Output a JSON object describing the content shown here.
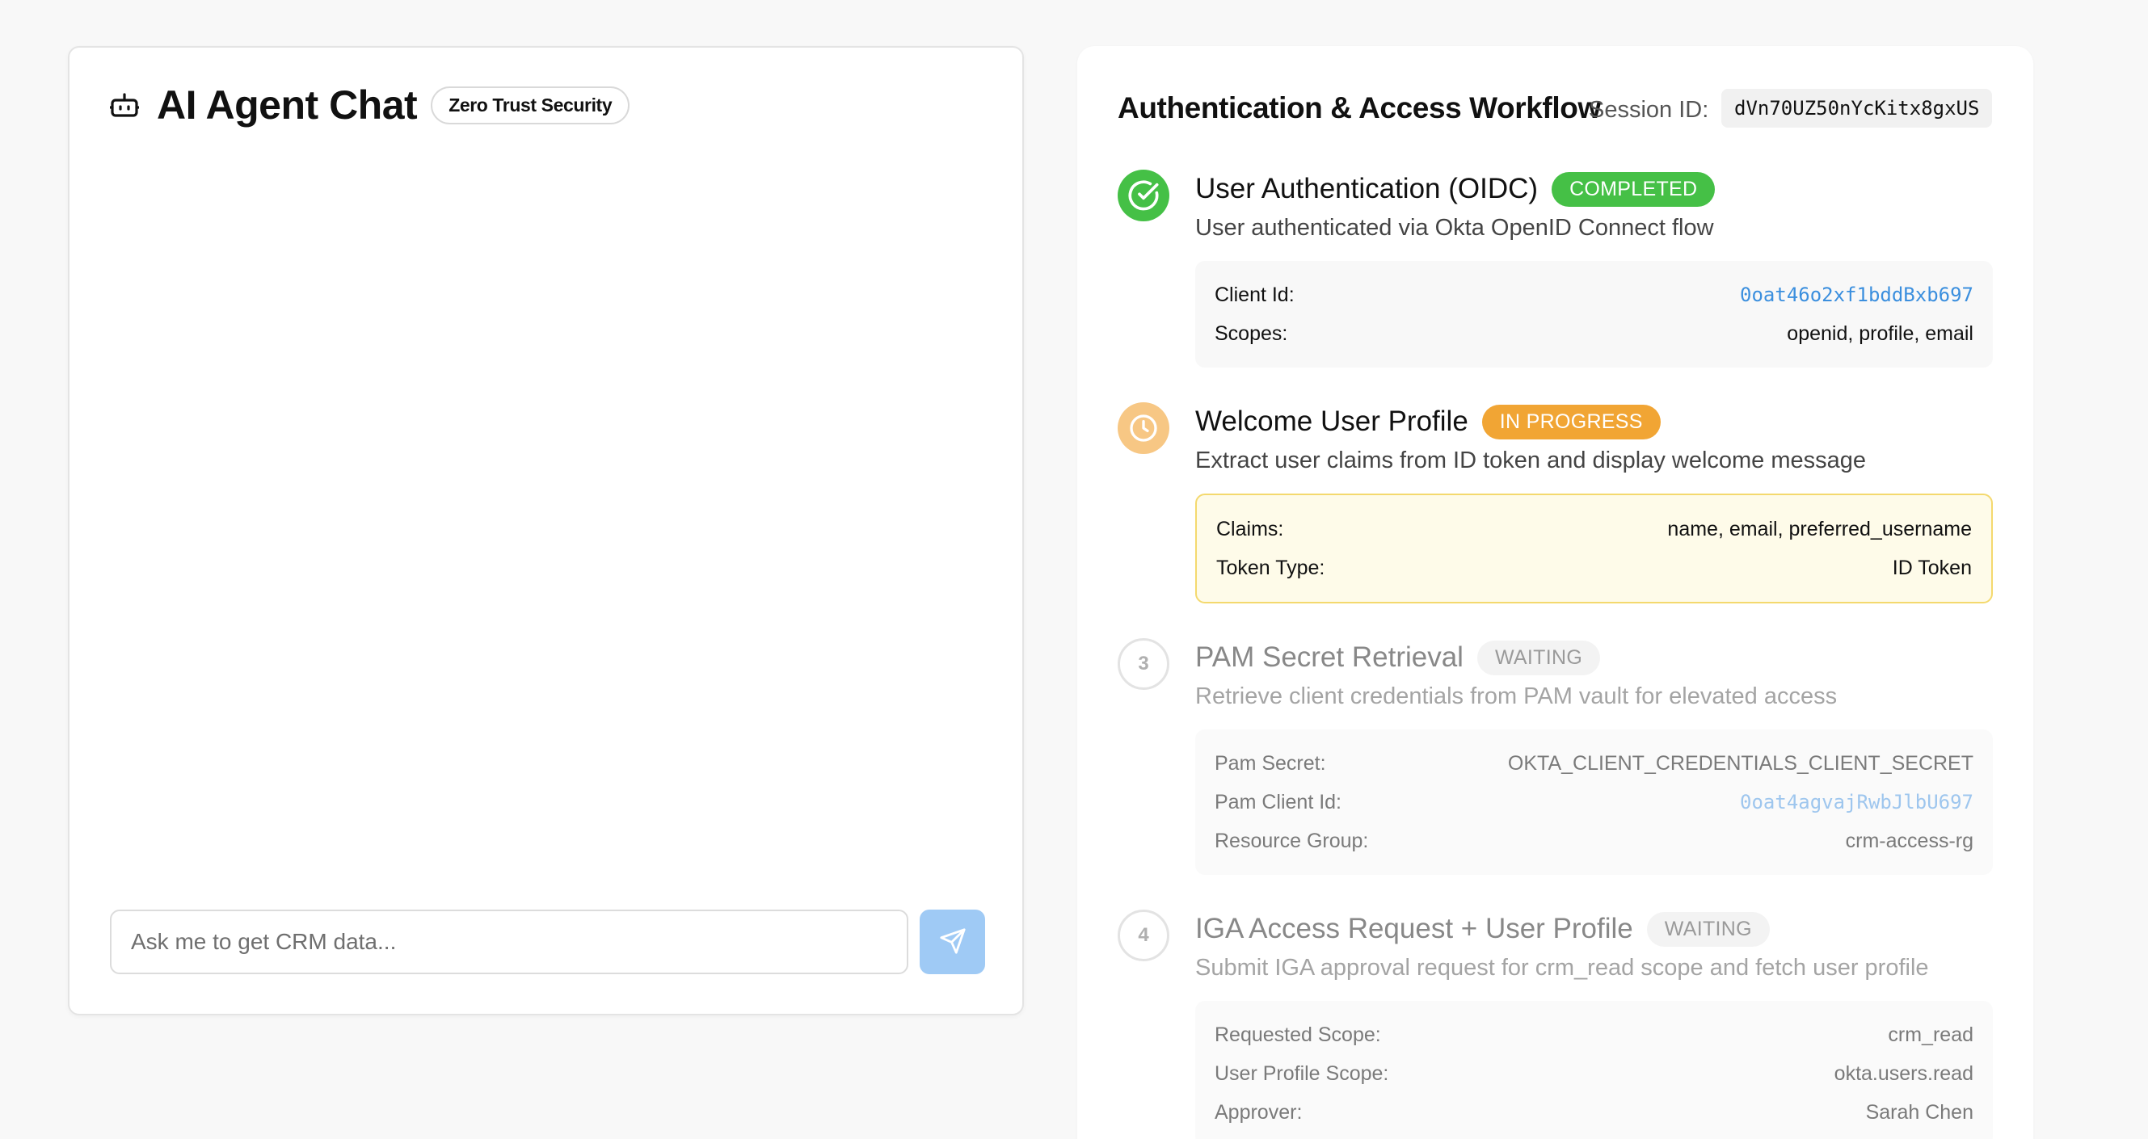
{
  "chat": {
    "title": "AI Agent Chat",
    "badge": "Zero Trust Security",
    "input_placeholder": "Ask me to get CRM data...",
    "icons": {
      "header": "robot-icon",
      "send": "send-icon"
    }
  },
  "workflow": {
    "title": "Authentication & Access Workflow",
    "session_label": "Session ID:",
    "session_id": "dVn70UZ50nYcKitx8gxUS",
    "colors": {
      "completed": "#45c046",
      "in_progress": "#f1a534",
      "waiting": "#9a9a9a",
      "link": "#3b8fde"
    },
    "steps": [
      {
        "number": "1",
        "name": "User Authentication (OIDC)",
        "status": "COMPLETED",
        "description": "User authenticated via Okta OpenID Connect flow",
        "icon": "check-circle-icon",
        "details": [
          {
            "key": "Client Id:",
            "value": "0oat46o2xf1bddBxb697"
          },
          {
            "key": "Scopes:",
            "value": "openid, profile, email"
          }
        ]
      },
      {
        "number": "2",
        "name": "Welcome User Profile",
        "status": "IN PROGRESS",
        "description": "Extract user claims from ID token and display welcome message",
        "icon": "clock-icon",
        "details": [
          {
            "key": "Claims:",
            "value": "name, email, preferred_username"
          },
          {
            "key": "Token Type:",
            "value": "ID Token"
          }
        ]
      },
      {
        "number": "3",
        "name": "PAM Secret Retrieval",
        "status": "WAITING",
        "description": "Retrieve client credentials from PAM vault for elevated access",
        "details": [
          {
            "key": "Pam Secret:",
            "value": "OKTA_CLIENT_CREDENTIALS_CLIENT_SECRET"
          },
          {
            "key": "Pam Client Id:",
            "value": "0oat4agvajRwbJlbU697"
          },
          {
            "key": "Resource Group:",
            "value": "crm-access-rg"
          }
        ]
      },
      {
        "number": "4",
        "name": "IGA Access Request + User Profile",
        "status": "WAITING",
        "description": "Submit IGA approval request for crm_read scope and fetch user profile",
        "details": [
          {
            "key": "Requested Scope:",
            "value": "crm_read"
          },
          {
            "key": "User Profile Scope:",
            "value": "okta.users.read"
          },
          {
            "key": "Approver:",
            "value": "Sarah Chen"
          }
        ]
      }
    ]
  }
}
